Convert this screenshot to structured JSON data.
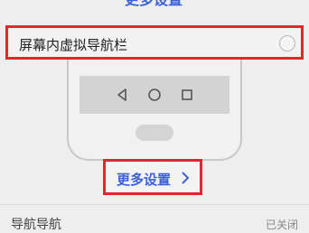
{
  "top_partial_link": "更多设置",
  "nav_option": {
    "label": "屏幕内虚拟导航栏",
    "selected": false
  },
  "nav_icons": [
    "back-icon",
    "home-icon",
    "recents-icon"
  ],
  "more_settings": {
    "label": "更多设置",
    "chevron": "›"
  },
  "bottom_row": {
    "label": "导航导航",
    "value": "已关闭"
  }
}
